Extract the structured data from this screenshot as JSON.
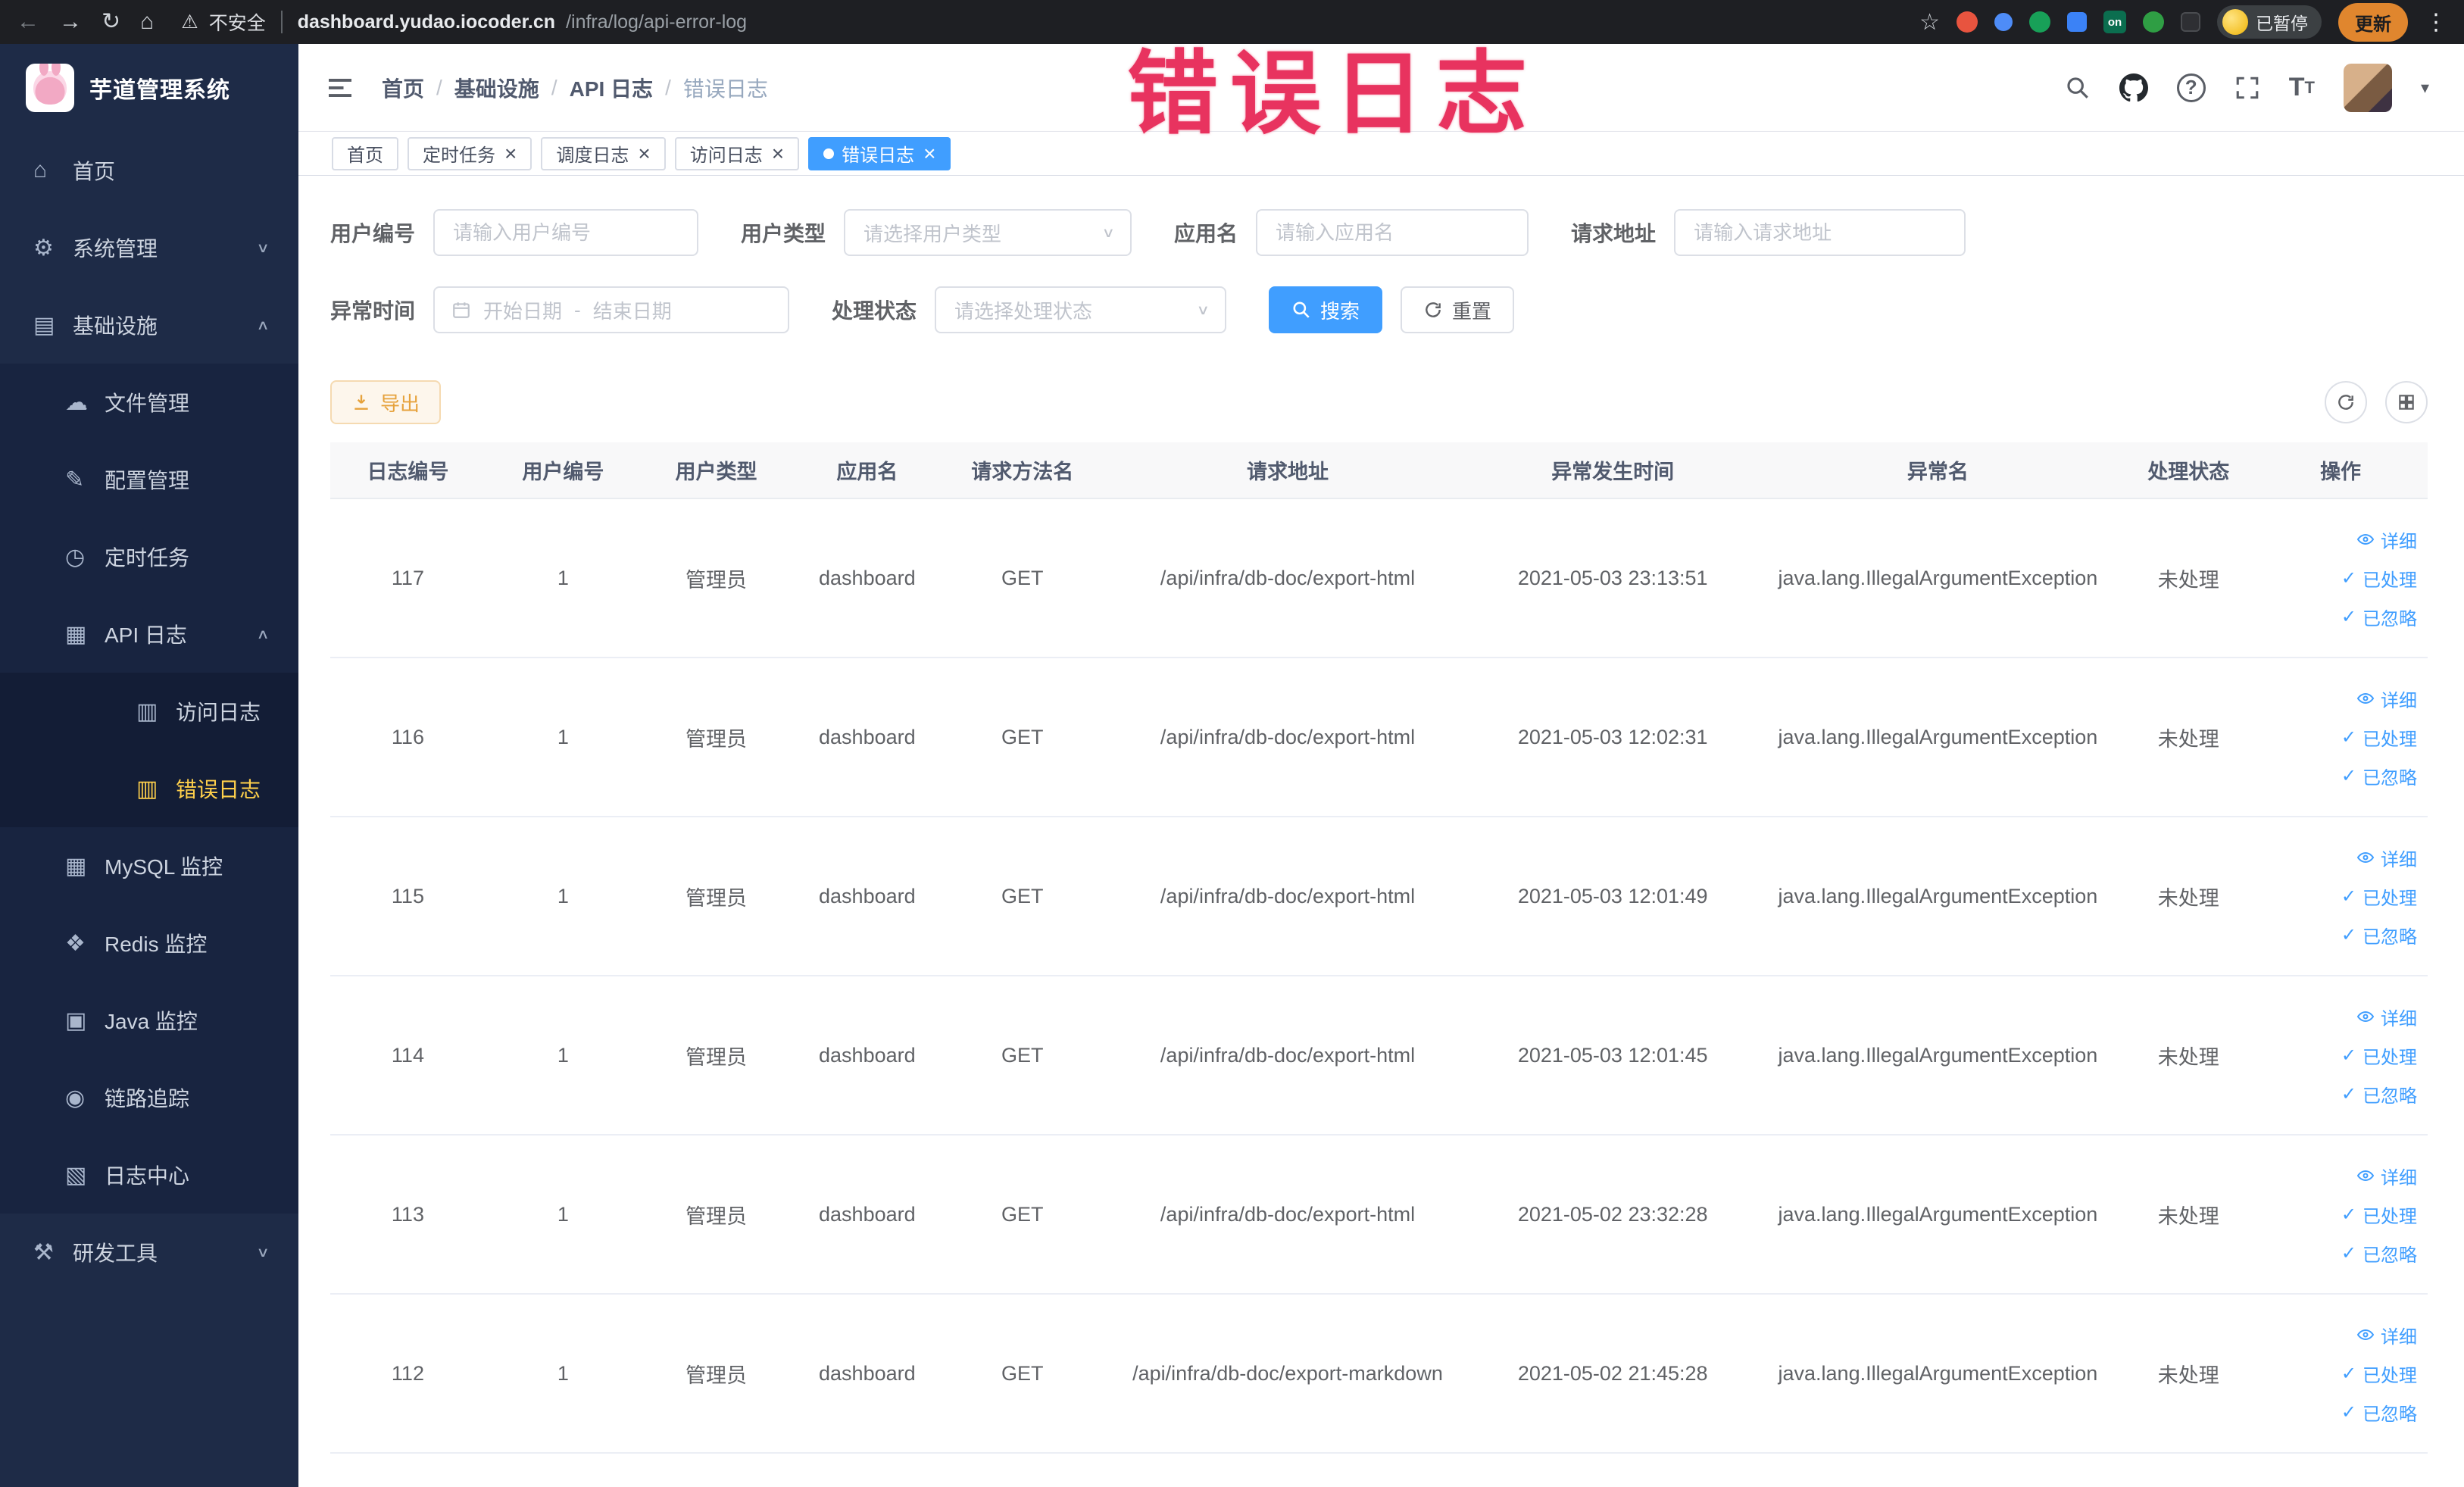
{
  "browser": {
    "security_label": "不安全",
    "url_host": "dashboard.yudao.iocoder.cn",
    "url_path": "/infra/log/api-error-log",
    "extension_badge": "on",
    "profile_status": "已暂停",
    "update_label": "更新"
  },
  "watermark_text": "错误日志",
  "accent_colors": {
    "primary": "#409eff",
    "sidebar_bg": "#1e2b47",
    "active_menu_text": "#ffd04b",
    "warning": "#e6a23c",
    "annotation_red": "#e8335f"
  },
  "icons": {
    "home-icon": "⌂",
    "gear-icon": "⚙",
    "infra-icon": "▤",
    "file-icon": "☁",
    "config-icon": "✎",
    "job-icon": "◷",
    "api-log-icon": "▦",
    "access-log-icon": "▥",
    "error-log-icon": "▥",
    "mysql-icon": "▦",
    "redis-icon": "❖",
    "java-icon": "▣",
    "trace-icon": "◉",
    "log-center-icon": "▧",
    "devtools-icon": "⚒",
    "chevron-up": "∧",
    "chevron-down": "∨"
  },
  "sidebar": {
    "logo_title": "芋道管理系统",
    "menu": [
      {
        "key": "home",
        "label": "首页",
        "icon": "home-icon",
        "level": 1
      },
      {
        "key": "system",
        "label": "系统管理",
        "icon": "gear-icon",
        "level": 1,
        "chevron": "down"
      },
      {
        "key": "infra",
        "label": "基础设施",
        "icon": "infra-icon",
        "level": 1,
        "chevron": "up"
      },
      {
        "key": "file",
        "label": "文件管理",
        "icon": "file-icon",
        "level": 2
      },
      {
        "key": "config",
        "label": "配置管理",
        "icon": "config-icon",
        "level": 2
      },
      {
        "key": "job",
        "label": "定时任务",
        "icon": "job-icon",
        "level": 2
      },
      {
        "key": "api-log",
        "label": "API 日志",
        "icon": "api-log-icon",
        "level": 2,
        "chevron": "up"
      },
      {
        "key": "access-log",
        "label": "访问日志",
        "icon": "access-log-icon",
        "level": 3
      },
      {
        "key": "error-log",
        "label": "错误日志",
        "icon": "error-log-icon",
        "level": 3,
        "active": true
      },
      {
        "key": "mysql",
        "label": "MySQL 监控",
        "icon": "mysql-icon",
        "level": 2
      },
      {
        "key": "redis",
        "label": "Redis 监控",
        "icon": "redis-icon",
        "level": 2
      },
      {
        "key": "java",
        "label": "Java 监控",
        "icon": "java-icon",
        "level": 2
      },
      {
        "key": "trace",
        "label": "链路追踪",
        "icon": "trace-icon",
        "level": 2
      },
      {
        "key": "log-center",
        "label": "日志中心",
        "icon": "log-center-icon",
        "level": 2
      },
      {
        "key": "devtools",
        "label": "研发工具",
        "icon": "devtools-icon",
        "level": 1,
        "chevron": "down"
      }
    ]
  },
  "header": {
    "breadcrumbs": [
      "首页",
      "基础设施",
      "API 日志",
      "错误日志"
    ]
  },
  "tabs": [
    {
      "key": "home",
      "label": "首页",
      "closable": false,
      "active": false
    },
    {
      "key": "job",
      "label": "定时任务",
      "closable": true,
      "active": false
    },
    {
      "key": "job-log",
      "label": "调度日志",
      "closable": true,
      "active": false
    },
    {
      "key": "access-log",
      "label": "访问日志",
      "closable": true,
      "active": false
    },
    {
      "key": "error-log",
      "label": "错误日志",
      "closable": true,
      "active": true
    }
  ],
  "filters": {
    "user_id": {
      "label": "用户编号",
      "placeholder": "请输入用户编号"
    },
    "user_type": {
      "label": "用户类型",
      "placeholder": "请选择用户类型"
    },
    "app_name": {
      "label": "应用名",
      "placeholder": "请输入应用名"
    },
    "request_url": {
      "label": "请求地址",
      "placeholder": "请输入请求地址"
    },
    "exception_time": {
      "label": "异常时间",
      "start_placeholder": "开始日期",
      "separator": "-",
      "end_placeholder": "结束日期"
    },
    "process_status": {
      "label": "处理状态",
      "placeholder": "请选择处理状态"
    },
    "search_label": "搜索",
    "reset_label": "重置"
  },
  "toolbar": {
    "export_label": "导出"
  },
  "table": {
    "columns": [
      "日志编号",
      "用户编号",
      "用户类型",
      "应用名",
      "请求方法名",
      "请求地址",
      "异常发生时间",
      "异常名",
      "处理状态",
      "操作"
    ],
    "actions": {
      "detail": "详细",
      "processed": "已处理",
      "ignored": "已忽略"
    },
    "rows": [
      {
        "id": "117",
        "user_id": "1",
        "user_type": "管理员",
        "app": "dashboard",
        "method": "GET",
        "url": "/api/infra/db-doc/export-html",
        "time": "2021-05-03 23:13:51",
        "exception": "java.lang.IllegalArgumentException",
        "status": "未处理"
      },
      {
        "id": "116",
        "user_id": "1",
        "user_type": "管理员",
        "app": "dashboard",
        "method": "GET",
        "url": "/api/infra/db-doc/export-html",
        "time": "2021-05-03 12:02:31",
        "exception": "java.lang.IllegalArgumentException",
        "status": "未处理"
      },
      {
        "id": "115",
        "user_id": "1",
        "user_type": "管理员",
        "app": "dashboard",
        "method": "GET",
        "url": "/api/infra/db-doc/export-html",
        "time": "2021-05-03 12:01:49",
        "exception": "java.lang.IllegalArgumentException",
        "status": "未处理"
      },
      {
        "id": "114",
        "user_id": "1",
        "user_type": "管理员",
        "app": "dashboard",
        "method": "GET",
        "url": "/api/infra/db-doc/export-html",
        "time": "2021-05-03 12:01:45",
        "exception": "java.lang.IllegalArgumentException",
        "status": "未处理"
      },
      {
        "id": "113",
        "user_id": "1",
        "user_type": "管理员",
        "app": "dashboard",
        "method": "GET",
        "url": "/api/infra/db-doc/export-html",
        "time": "2021-05-02 23:32:28",
        "exception": "java.lang.IllegalArgumentException",
        "status": "未处理"
      },
      {
        "id": "112",
        "user_id": "1",
        "user_type": "管理员",
        "app": "dashboard",
        "method": "GET",
        "url": "/api/infra/db-doc/export-markdown",
        "time": "2021-05-02 21:45:28",
        "exception": "java.lang.IllegalArgumentException",
        "status": "未处理"
      }
    ]
  }
}
